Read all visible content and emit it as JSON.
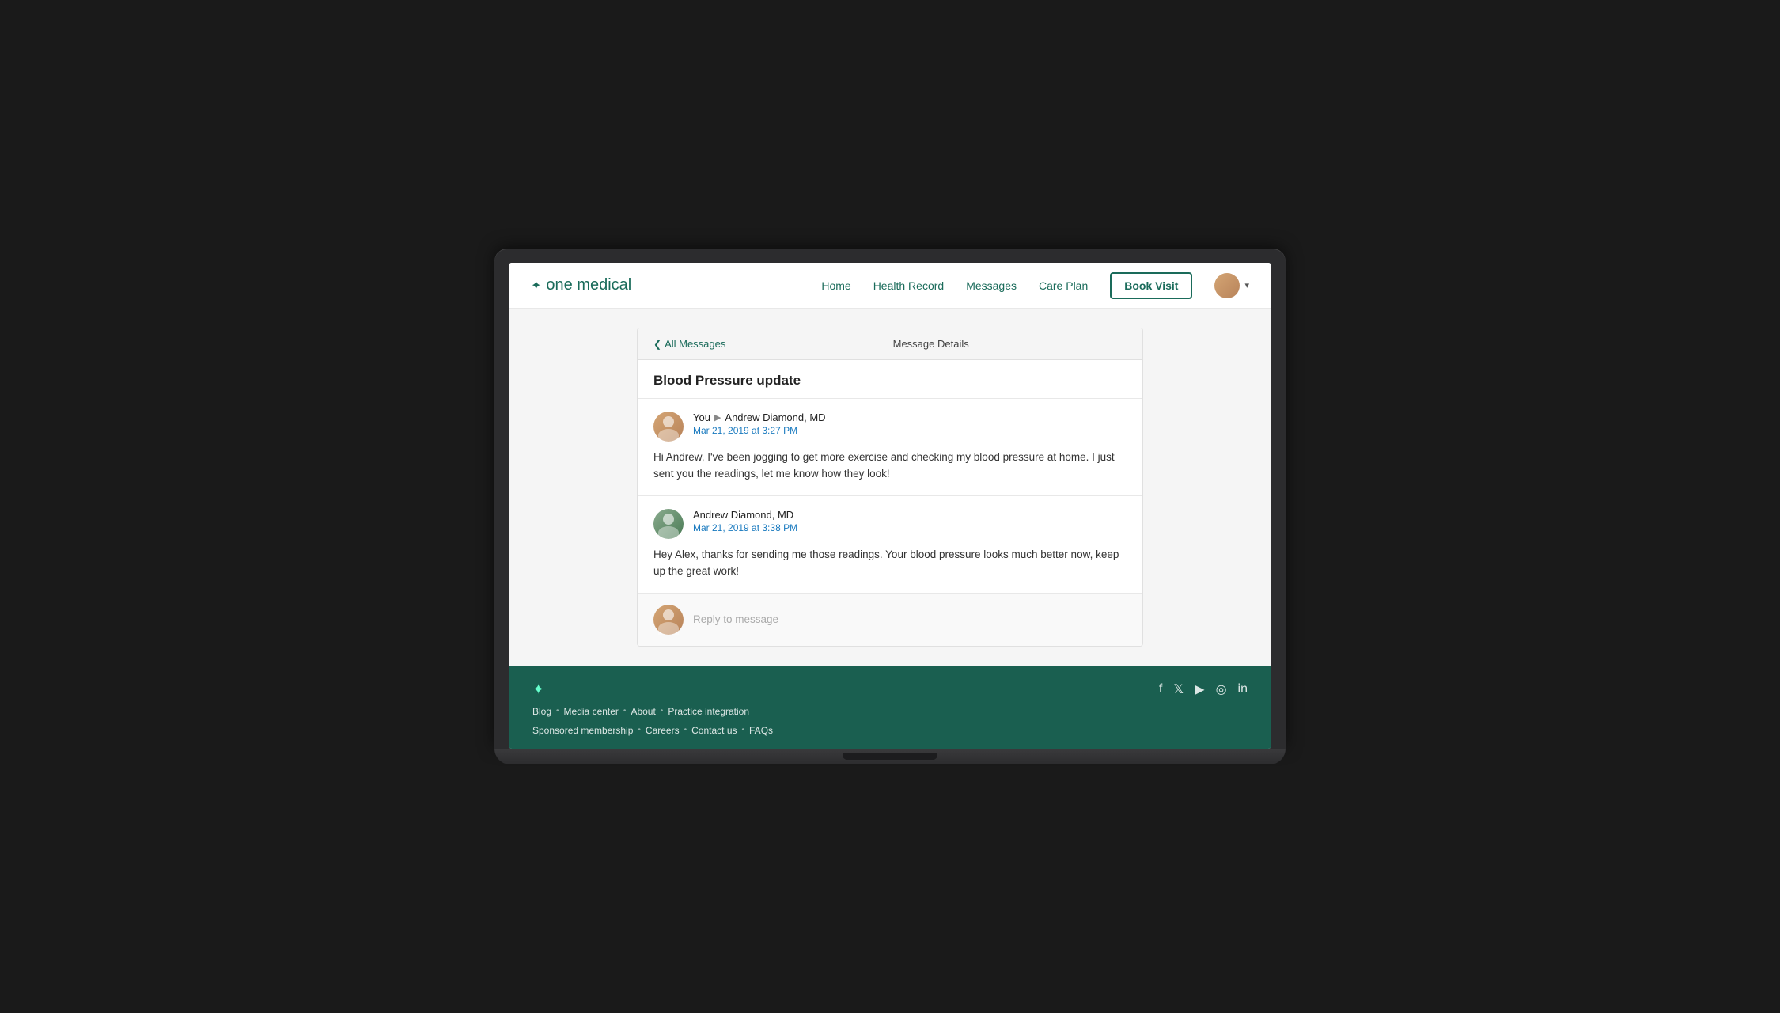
{
  "brand": {
    "name": "one medical",
    "logo_symbol": "✦"
  },
  "nav": {
    "home": "Home",
    "health_record": "Health Record",
    "messages": "Messages",
    "care_plan": "Care Plan",
    "book_visit": "Book Visit",
    "chevron": "▾"
  },
  "breadcrumb": {
    "back_label": "All Messages",
    "current_label": "Message Details"
  },
  "message_thread": {
    "subject": "Blood Pressure update",
    "messages": [
      {
        "sender": "You",
        "arrow": "▶",
        "recipient": "Andrew Diamond, MD",
        "timestamp": "Mar 21, 2019 at 3:27 PM",
        "body": "Hi Andrew, I've been jogging to get more exercise and checking my blood pressure at home. I just sent you the readings, let me know how they look!"
      },
      {
        "sender": "Andrew Diamond, MD",
        "timestamp": "Mar 21, 2019 at 3:38 PM",
        "body": "Hey Alex, thanks for sending me those readings. Your blood pressure looks much better now, keep up the great work!"
      }
    ],
    "reply_placeholder": "Reply to message"
  },
  "footer": {
    "links_row1": [
      {
        "label": "Blog"
      },
      {
        "label": "Media center"
      },
      {
        "label": "About"
      },
      {
        "label": "Practice integration"
      }
    ],
    "links_row2": [
      {
        "label": "Sponsored membership"
      },
      {
        "label": "Careers"
      },
      {
        "label": "Contact us"
      },
      {
        "label": "FAQs"
      }
    ],
    "social_icons": [
      "f",
      "t",
      "▶",
      "◎",
      "in"
    ]
  }
}
